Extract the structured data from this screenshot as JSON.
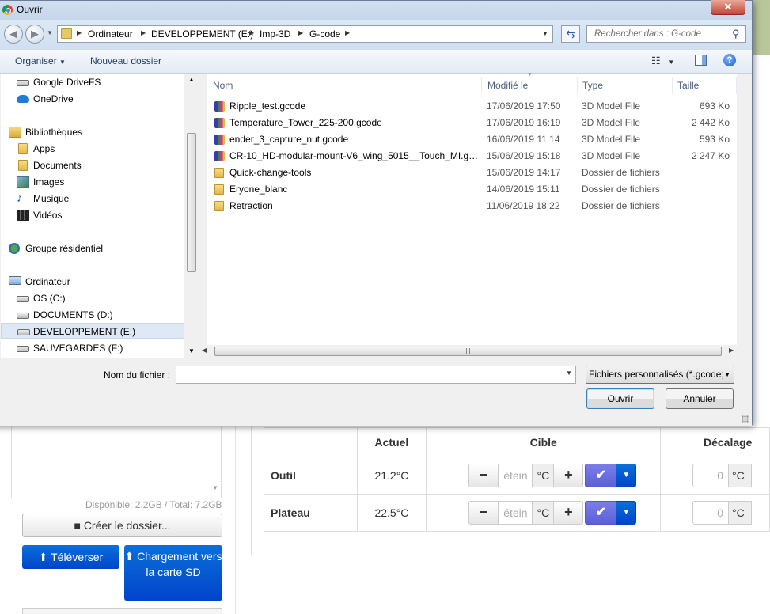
{
  "dialog": {
    "title": "Ouvrir",
    "close_symbol": "✕"
  },
  "address": {
    "crumbs": [
      "Ordinateur",
      "DEVELOPPEMENT (E:)",
      "Imp-3D",
      "G-code"
    ],
    "search_placeholder": "Rechercher dans : G-code"
  },
  "toolbar": {
    "organiser": "Organiser",
    "new_folder": "Nouveau dossier"
  },
  "nav": {
    "items": [
      {
        "label": "Google DriveFS",
        "icon": "drive-icon"
      },
      {
        "label": "OneDrive",
        "icon": "cloud-icon"
      },
      {
        "label": "Bibliothèques",
        "icon": "library-icon"
      },
      {
        "label": "Apps",
        "icon": "folder-icon"
      },
      {
        "label": "Documents",
        "icon": "documents-icon"
      },
      {
        "label": "Images",
        "icon": "images-icon"
      },
      {
        "label": "Musique",
        "icon": "music-icon"
      },
      {
        "label": "Vidéos",
        "icon": "video-icon"
      },
      {
        "label": "Groupe résidentiel",
        "icon": "homegroup-icon"
      },
      {
        "label": "Ordinateur",
        "icon": "computer-icon"
      },
      {
        "label": "OS (C:)",
        "icon": "drive-icon"
      },
      {
        "label": "DOCUMENTS (D:)",
        "icon": "drive-icon"
      },
      {
        "label": "DEVELOPPEMENT (E:)",
        "icon": "drive-icon"
      },
      {
        "label": "SAUVEGARDES (F:)",
        "icon": "drive-icon"
      }
    ],
    "selected": "DEVELOPPEMENT (E:)"
  },
  "files": {
    "columns": [
      "Nom",
      "Modifié le",
      "Type",
      "Taille"
    ],
    "rows": [
      {
        "name": "Ripple_test.gcode",
        "date": "17/06/2019 17:50",
        "type": "3D Model File",
        "size": "693 Ko",
        "icon": "3d-model-icon"
      },
      {
        "name": "Temperature_Tower_225-200.gcode",
        "date": "17/06/2019 16:19",
        "type": "3D Model File",
        "size": "2 442 Ko",
        "icon": "3d-model-icon"
      },
      {
        "name": "ender_3_capture_nut.gcode",
        "date": "16/06/2019 11:14",
        "type": "3D Model File",
        "size": "593 Ko",
        "icon": "3d-model-icon"
      },
      {
        "name": "CR-10_HD-modular-mount-V6_wing_5015__Touch_MI.gc...",
        "date": "15/06/2019 15:18",
        "type": "3D Model File",
        "size": "2 247 Ko",
        "icon": "3d-model-icon"
      },
      {
        "name": "Quick-change-tools",
        "date": "15/06/2019 14:17",
        "type": "Dossier de fichiers",
        "size": "",
        "icon": "folder-icon"
      },
      {
        "name": "Eryone_blanc",
        "date": "14/06/2019 15:11",
        "type": "Dossier de fichiers",
        "size": "",
        "icon": "folder-icon"
      },
      {
        "name": "Retraction",
        "date": "11/06/2019 18:22",
        "type": "Dossier de fichiers",
        "size": "",
        "icon": "folder-icon"
      }
    ]
  },
  "bottom": {
    "filename_label": "Nom du fichier :",
    "filename_value": "",
    "filter": "Fichiers personnalisés (*.gcode;",
    "open": "Ouvrir",
    "cancel": "Annuler"
  },
  "background": {
    "disk_info": "Disponible: 2.2GB / Total: 7.2GB",
    "mkdir": "Créer le dossier...",
    "upload": "Téléverser",
    "sd_upload": "Chargement vers la carte SD",
    "temp_headers": [
      "",
      "Actuel",
      "Cible",
      "Décalage"
    ],
    "temp_rows": [
      {
        "name": "Outil",
        "actual": "21.2°C",
        "target_placeholder": "étein",
        "unit": "°C",
        "offset": "0"
      },
      {
        "name": "Plateau",
        "actual": "22.5°C",
        "target_placeholder": "étein",
        "unit": "°C",
        "offset": "0"
      }
    ]
  }
}
